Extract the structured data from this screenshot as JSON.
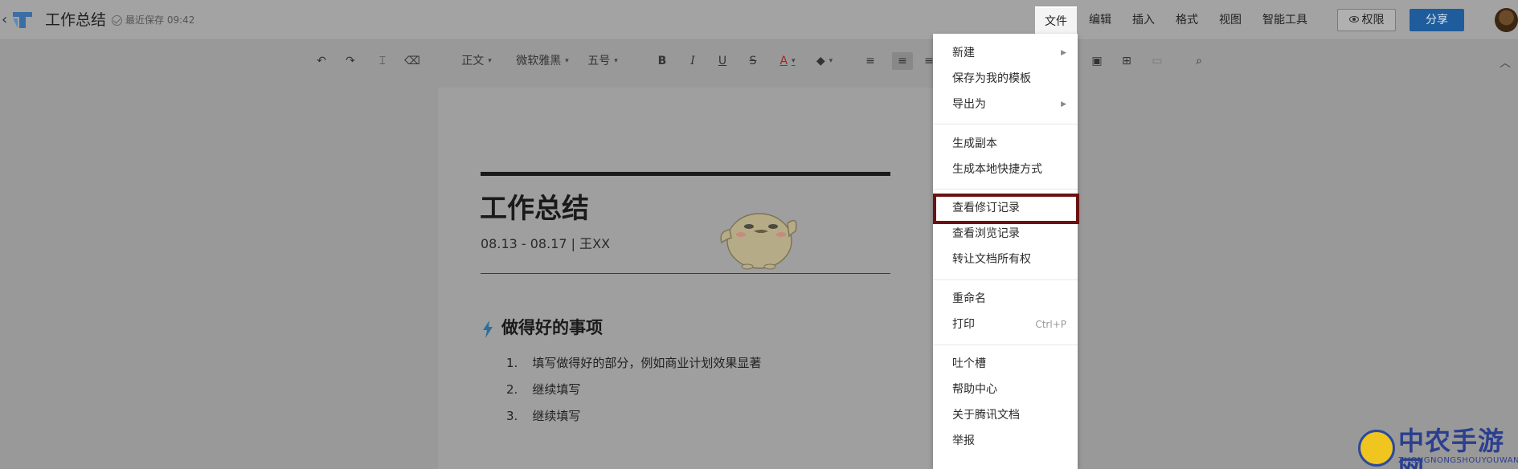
{
  "header": {
    "title": "工作总结",
    "save_status": "最近保存 09:42",
    "menus": [
      "文件",
      "编辑",
      "插入",
      "格式",
      "视图",
      "智能工具"
    ],
    "permission_label": "权限",
    "share_label": "分享"
  },
  "toolbar": {
    "paragraph_style": "正文",
    "font_family": "微软雅黑",
    "font_size": "五号"
  },
  "document": {
    "title": "工作总结",
    "subtitle": "08.13 - 08.17 | 王XX",
    "section_title": "做得好的事项",
    "list": [
      {
        "num": "1.",
        "text": "填写做得好的部分，例如商业计划效果显著"
      },
      {
        "num": "2.",
        "text": "继续填写"
      },
      {
        "num": "3.",
        "text": "继续填写"
      }
    ]
  },
  "file_menu": {
    "items": [
      {
        "label": "新建",
        "submenu": true
      },
      {
        "label": "保存为我的模板"
      },
      {
        "label": "导出为",
        "submenu": true
      },
      {
        "label": "生成副本"
      },
      {
        "label": "生成本地快捷方式"
      },
      {
        "label": "查看修订记录",
        "highlighted": true
      },
      {
        "label": "查看浏览记录"
      },
      {
        "label": "转让文档所有权"
      },
      {
        "label": "重命名"
      },
      {
        "label": "打印",
        "shortcut": "Ctrl+P"
      },
      {
        "label": "吐个槽"
      },
      {
        "label": "帮助中心"
      },
      {
        "label": "关于腾讯文档"
      },
      {
        "label": "举报"
      }
    ]
  },
  "watermark": {
    "text": "中农手游网",
    "sub": "ZHONGNONGSHOUYOUWANG"
  },
  "colors": {
    "share_button": "#1f5c9c",
    "highlight_border": "#6b1111",
    "overlay": "#999999"
  }
}
